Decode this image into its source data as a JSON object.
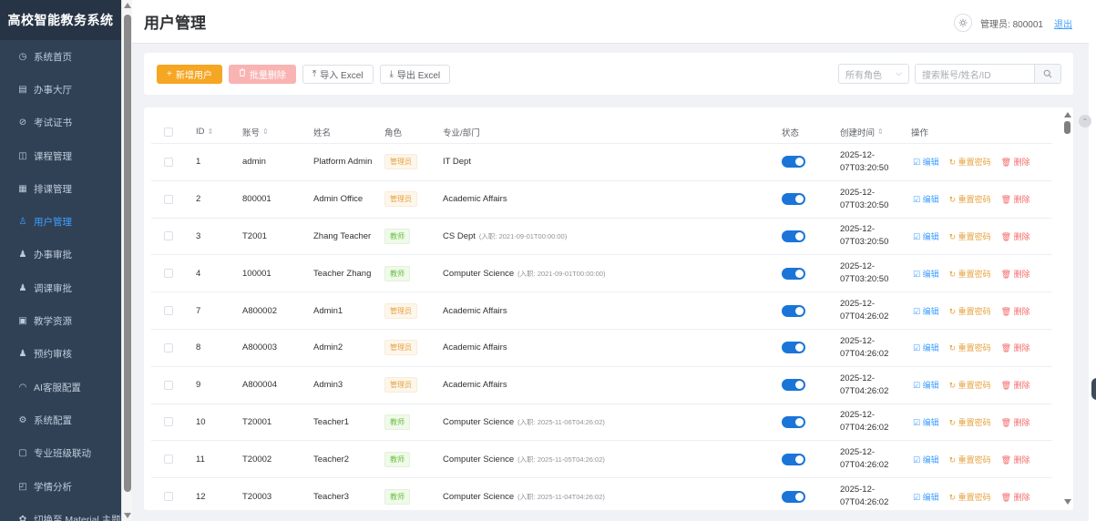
{
  "app": {
    "brand": "高校智能教务系统"
  },
  "sidebar": {
    "items": [
      {
        "label": "系统首页",
        "icon": "dashboard-icon",
        "active": false
      },
      {
        "label": "办事大厅",
        "icon": "building-icon",
        "active": false
      },
      {
        "label": "考试证书",
        "icon": "link-icon",
        "active": false
      },
      {
        "label": "课程管理",
        "icon": "book-icon",
        "active": false
      },
      {
        "label": "排课管理",
        "icon": "calendar-icon",
        "active": false
      },
      {
        "label": "用户管理",
        "icon": "user-icon",
        "active": true
      },
      {
        "label": "办事审批",
        "icon": "user-check-icon",
        "active": false
      },
      {
        "label": "调课审批",
        "icon": "user-check-icon",
        "active": false
      },
      {
        "label": "教学资源",
        "icon": "folder-icon",
        "active": false
      },
      {
        "label": "预约审核",
        "icon": "user-check-icon",
        "active": false
      },
      {
        "label": "AI客服配置",
        "icon": "headset-icon",
        "active": false
      },
      {
        "label": "系统配置",
        "icon": "gear-icon",
        "active": false
      },
      {
        "label": "专业班级联动",
        "icon": "notebook-icon",
        "active": false
      },
      {
        "label": "学情分析",
        "icon": "chart-icon",
        "active": false
      },
      {
        "label": "切换至 Material 主题",
        "icon": "palette-icon",
        "active": false
      }
    ]
  },
  "header": {
    "title": "用户管理",
    "admin_label": "管理员: 800001",
    "logout": "退出"
  },
  "toolbar": {
    "add_user": "新增用户",
    "batch_delete": "批量删除",
    "import_excel": "导入 Excel",
    "export_excel": "导出 Excel",
    "role_select_value": "所有角色",
    "search_placeholder": "搜索账号/姓名/ID"
  },
  "table": {
    "columns": {
      "id": "ID",
      "account": "账号",
      "name": "姓名",
      "role": "角色",
      "dept": "专业/部门",
      "status": "状态",
      "created": "创建时间",
      "actions": "操作"
    },
    "actions": {
      "edit": "编辑",
      "reset": "重置密码",
      "delete": "删除"
    },
    "rows": [
      {
        "id": "1",
        "account": "admin",
        "name": "Platform Admin",
        "role": "管理员",
        "role_type": "admin",
        "dept": "IT Dept",
        "hire": "",
        "status_on": true,
        "created_date": "2025-12-",
        "created_time": "07T03:20:50"
      },
      {
        "id": "2",
        "account": "800001",
        "name": "Admin Office",
        "role": "管理员",
        "role_type": "admin",
        "dept": "Academic Affairs",
        "hire": "",
        "status_on": true,
        "created_date": "2025-12-",
        "created_time": "07T03:20:50"
      },
      {
        "id": "3",
        "account": "T2001",
        "name": "Zhang Teacher",
        "role": "教师",
        "role_type": "teacher",
        "dept": "CS Dept",
        "hire": "(入职: 2021-09-01T00:00:00)",
        "status_on": true,
        "created_date": "2025-12-",
        "created_time": "07T03:20:50"
      },
      {
        "id": "4",
        "account": "100001",
        "name": "Teacher Zhang",
        "role": "教师",
        "role_type": "teacher",
        "dept": "Computer Science",
        "hire": "(入职: 2021-09-01T00:00:00)",
        "status_on": true,
        "created_date": "2025-12-",
        "created_time": "07T03:20:50"
      },
      {
        "id": "7",
        "account": "A800002",
        "name": "Admin1",
        "role": "管理员",
        "role_type": "admin",
        "dept": "Academic Affairs",
        "hire": "",
        "status_on": true,
        "created_date": "2025-12-",
        "created_time": "07T04:26:02"
      },
      {
        "id": "8",
        "account": "A800003",
        "name": "Admin2",
        "role": "管理员",
        "role_type": "admin",
        "dept": "Academic Affairs",
        "hire": "",
        "status_on": true,
        "created_date": "2025-12-",
        "created_time": "07T04:26:02"
      },
      {
        "id": "9",
        "account": "A800004",
        "name": "Admin3",
        "role": "管理员",
        "role_type": "admin",
        "dept": "Academic Affairs",
        "hire": "",
        "status_on": true,
        "created_date": "2025-12-",
        "created_time": "07T04:26:02"
      },
      {
        "id": "10",
        "account": "T20001",
        "name": "Teacher1",
        "role": "教师",
        "role_type": "teacher",
        "dept": "Computer Science",
        "hire": "(入职: 2025-11-06T04:26:02)",
        "status_on": true,
        "created_date": "2025-12-",
        "created_time": "07T04:26:02"
      },
      {
        "id": "11",
        "account": "T20002",
        "name": "Teacher2",
        "role": "教师",
        "role_type": "teacher",
        "dept": "Computer Science",
        "hire": "(入职: 2025-11-05T04:26:02)",
        "status_on": true,
        "created_date": "2025-12-",
        "created_time": "07T04:26:02"
      },
      {
        "id": "12",
        "account": "T20003",
        "name": "Teacher3",
        "role": "教师",
        "role_type": "teacher",
        "dept": "Computer Science",
        "hire": "(入职: 2025-11-04T04:26:02)",
        "status_on": true,
        "created_date": "2025-12-",
        "created_time": "07T04:26:02"
      }
    ]
  }
}
